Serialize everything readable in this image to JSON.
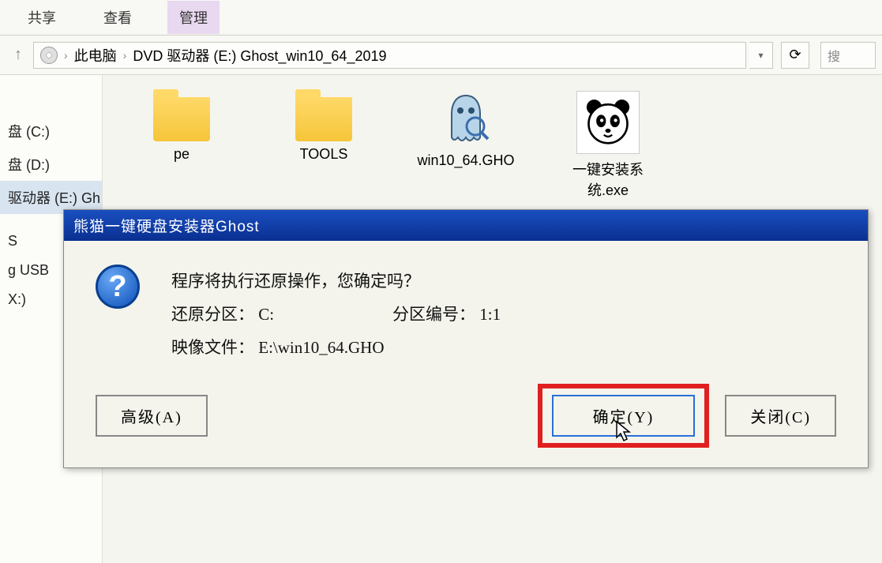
{
  "ribbon": {
    "share": "共享",
    "view": "查看",
    "manage": "管理"
  },
  "breadcrumb": {
    "pc": "此电脑",
    "drive": "DVD 驱动器 (E:) Ghost_win10_64_2019"
  },
  "search_placeholder": "搜",
  "sidebar": {
    "items": [
      "盘 (C:)",
      "盘 (D:)",
      "驱动器 (E:) Gh",
      "",
      "S",
      "g USB",
      "X:)"
    ]
  },
  "files": [
    {
      "name": "pe",
      "type": "folder"
    },
    {
      "name": "TOOLS",
      "type": "folder"
    },
    {
      "name": "win10_64.GHO",
      "type": "ghost"
    },
    {
      "name": "一键安装系统.exe",
      "type": "panda"
    }
  ],
  "dialog": {
    "title": "熊猫一键硬盘安装器Ghost",
    "question": "程序将执行还原操作，您确定吗？",
    "partition_label": "还原分区：",
    "partition_value": "C:",
    "partnum_label": "分区编号：",
    "partnum_value": "1:1",
    "image_label": "映像文件：",
    "image_value": "E:\\win10_64.GHO",
    "btn_advanced": "高级(A)",
    "btn_confirm": "确定(Y)",
    "btn_close": "关闭(C)"
  }
}
